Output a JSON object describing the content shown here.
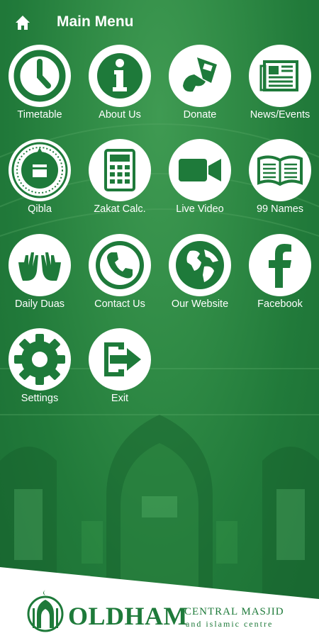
{
  "header": {
    "title": "Main Menu",
    "home_icon": "home-icon"
  },
  "menu": [
    {
      "label": "Timetable",
      "icon": "clock-icon"
    },
    {
      "label": "About Us",
      "icon": "info-icon"
    },
    {
      "label": "Donate",
      "icon": "donate-hand-icon"
    },
    {
      "label": "News/Events",
      "icon": "newspaper-icon"
    },
    {
      "label": "Qibla",
      "icon": "qibla-compass-icon"
    },
    {
      "label": "Zakat Calc.",
      "icon": "calculator-icon"
    },
    {
      "label": "Live Video",
      "icon": "video-camera-icon"
    },
    {
      "label": "99 Names",
      "icon": "open-book-icon"
    },
    {
      "label": "Daily Duas",
      "icon": "praying-hands-icon"
    },
    {
      "label": "Contact Us",
      "icon": "phone-icon"
    },
    {
      "label": "Our Website",
      "icon": "globe-icon"
    },
    {
      "label": "Facebook",
      "icon": "facebook-icon"
    },
    {
      "label": "Settings",
      "icon": "gear-icon"
    },
    {
      "label": "Exit",
      "icon": "exit-icon"
    }
  ],
  "footer": {
    "logo_main": "OLDHAM",
    "logo_sub1": "CENTRAL MASJID",
    "logo_sub2": "and islamic centre"
  },
  "colors": {
    "primary_green": "#1e7a3a",
    "icon_bg": "#ffffff",
    "text": "#ffffff"
  }
}
